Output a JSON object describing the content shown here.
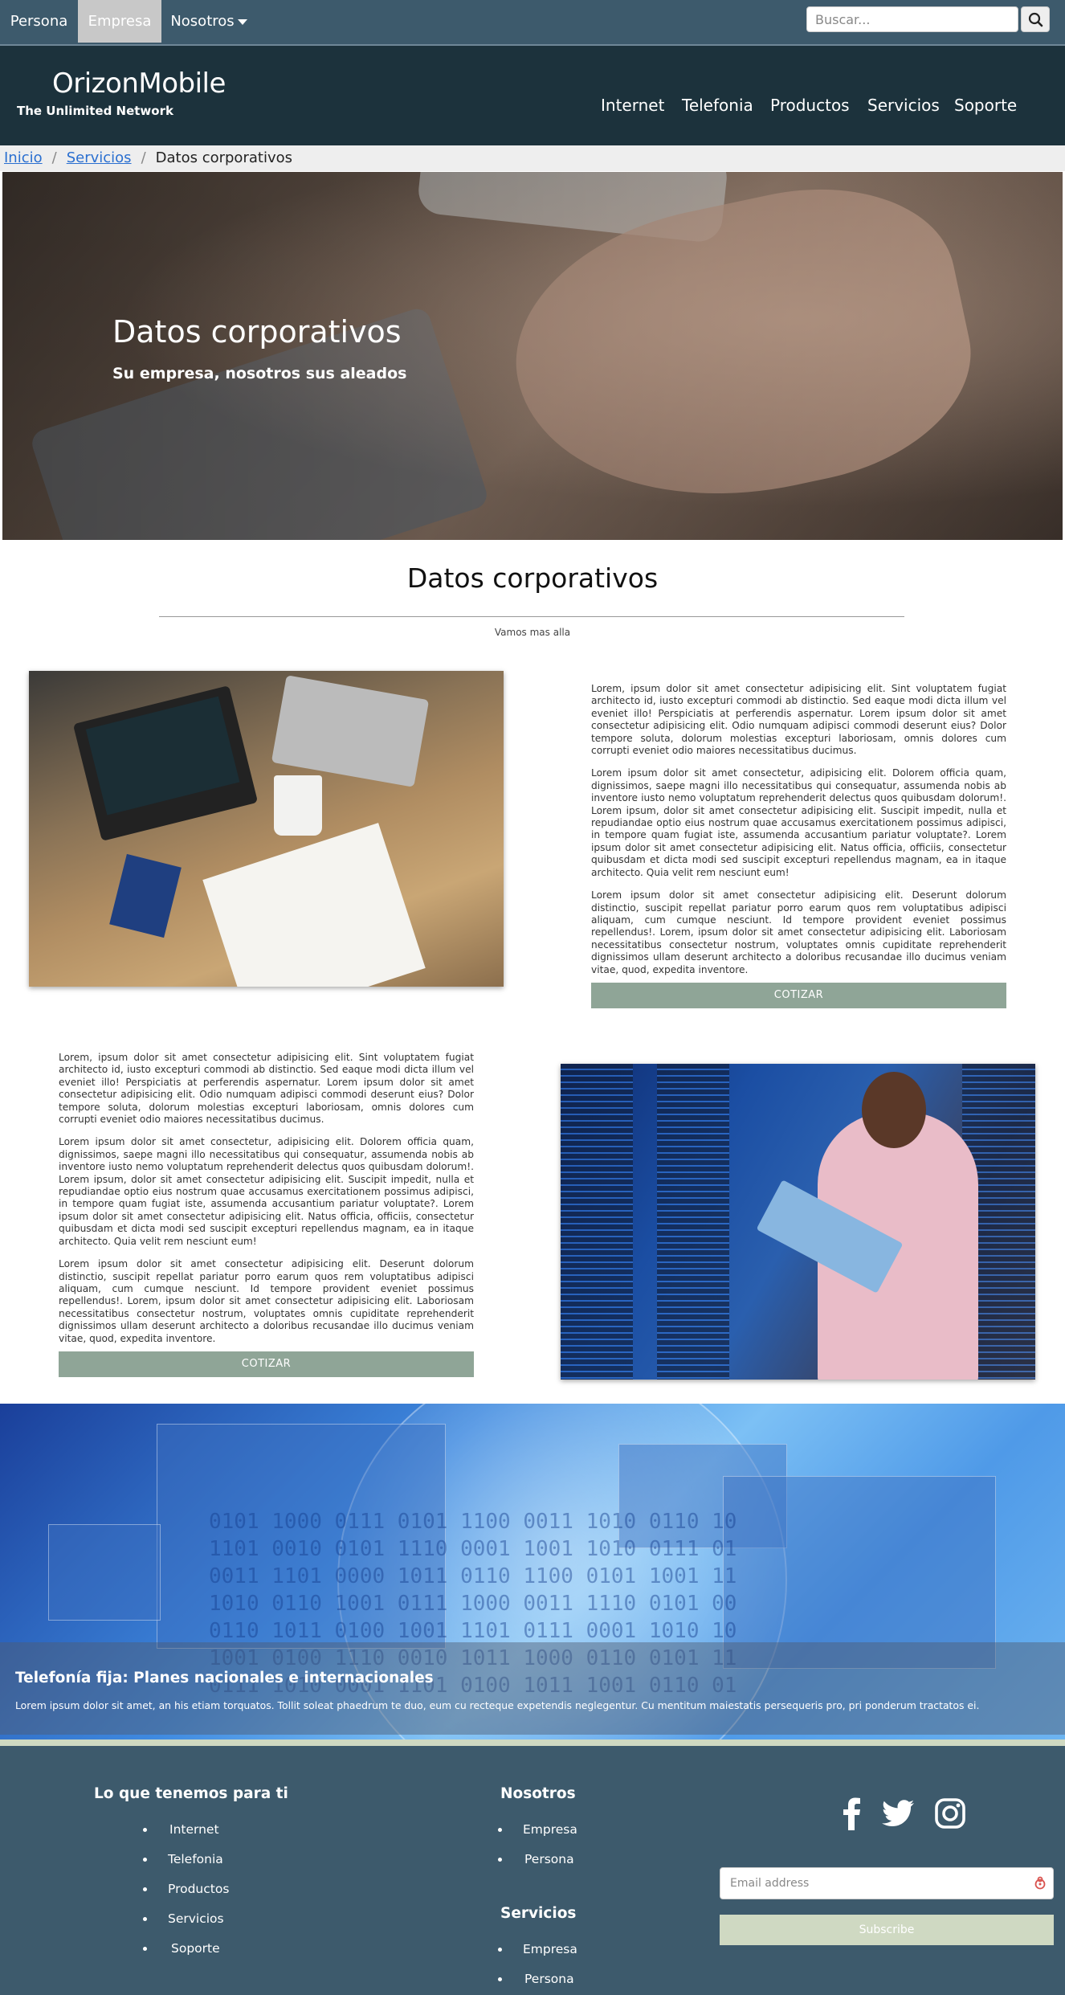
{
  "topbar": {
    "tabs": [
      {
        "label": "Persona"
      },
      {
        "label": "Empresa"
      },
      {
        "label": "Nosotros"
      }
    ],
    "search_placeholder": "Buscar..."
  },
  "header": {
    "brand": "OrizonMobile",
    "tagline": "The Unlimited Network",
    "nav": [
      "Internet",
      "Telefonia",
      "Productos",
      "Servicios",
      "Soporte"
    ]
  },
  "breadcrumb": [
    "Inicio",
    "Servicios",
    "Datos corporativos"
  ],
  "hero": {
    "title": "Datos corporativos",
    "subtitle": "Su empresa, nosotros sus aleados"
  },
  "section": {
    "title": "Datos corporativos",
    "subtitle": "Vamos mas alla"
  },
  "block1": {
    "paragraphs": [
      "Lorem, ipsum dolor sit amet consectetur adipisicing elit. Sint voluptatem fugiat architecto id, iusto excepturi commodi ab distinctio. Sed eaque modi dicta illum vel eveniet illo! Perspiciatis at perferendis aspernatur. Lorem ipsum dolor sit amet consectetur adipisicing elit. Odio numquam adipisci commodi deserunt eius? Dolor tempore soluta, dolorum molestias excepturi laboriosam, omnis dolores cum corrupti eveniet odio maiores necessitatibus ducimus.",
      "Lorem ipsum dolor sit amet consectetur, adipisicing elit. Dolorem officia quam, dignissimos, saepe magni illo necessitatibus qui consequatur, assumenda nobis ab inventore iusto nemo voluptatum reprehenderit delectus quos quibusdam dolorum!. Lorem ipsum, dolor sit amet consectetur adipisicing elit. Suscipit impedit, nulla et repudiandae optio eius nostrum quae accusamus exercitationem possimus adipisci, in tempore quam fugiat iste, assumenda accusantium pariatur voluptate?. Lorem ipsum dolor sit amet consectetur adipisicing elit. Natus officia, officiis, consectetur quibusdam et dicta modi sed suscipit excepturi repellendus magnam, ea in itaque architecto. Quia velit rem nesciunt eum!",
      "Lorem ipsum dolor sit amet consectetur adipisicing elit. Deserunt dolorum distinctio, suscipit repellat pariatur porro earum quos rem voluptatibus adipisci aliquam, cum cumque nesciunt. Id tempore provident eveniet possimus repellendus!. Lorem, ipsum dolor sit amet consectetur adipisicing elit. Laboriosam necessitatibus consectetur nostrum, voluptates omnis cupiditate reprehenderit dignissimos ullam deserunt architecto a doloribus recusandae illo ducimus veniam vitae, quod, expedita inventore."
    ],
    "button": "COTIZAR"
  },
  "block2": {
    "paragraphs": [
      "Lorem, ipsum dolor sit amet consectetur adipisicing elit. Sint voluptatem fugiat architecto id, iusto excepturi commodi ab distinctio. Sed eaque modi dicta illum vel eveniet illo! Perspiciatis at perferendis aspernatur. Lorem ipsum dolor sit amet consectetur adipisicing elit. Odio numquam adipisci commodi deserunt eius? Dolor tempore soluta, dolorum molestias excepturi laboriosam, omnis dolores cum corrupti eveniet odio maiores necessitatibus ducimus.",
      "Lorem ipsum dolor sit amet consectetur, adipisicing elit. Dolorem officia quam, dignissimos, saepe magni illo necessitatibus qui consequatur, assumenda nobis ab inventore iusto nemo voluptatum reprehenderit delectus quos quibusdam dolorum!. Lorem ipsum, dolor sit amet consectetur adipisicing elit. Suscipit impedit, nulla et repudiandae optio eius nostrum quae accusamus exercitationem possimus adipisci, in tempore quam fugiat iste, assumenda accusantium pariatur voluptate?. Lorem ipsum dolor sit amet consectetur adipisicing elit. Natus officia, officiis, consectetur quibusdam et dicta modi sed suscipit excepturi repellendus magnam, ea in itaque architecto. Quia velit rem nesciunt eum!",
      "Lorem ipsum dolor sit amet consectetur adipisicing elit. Deserunt dolorum distinctio, suscipit repellat pariatur porro earum quos rem voluptatibus adipisci aliquam, cum cumque nesciunt. Id tempore provident eveniet possimus repellendus!. Lorem, ipsum dolor sit amet consectetur adipisicing elit. Laboriosam necessitatibus consectetur nostrum, voluptates omnis cupiditate reprehenderit dignissimos ullam deserunt architecto a doloribus recusandae illo ducimus veniam vitae, quod, expedita inventore."
    ],
    "button": "COTIZAR"
  },
  "banner": {
    "title": "Telefonía fija: Planes nacionales e internacionales",
    "text": "Lorem ipsum dolor sit amet, an his etiam torquatos. Tollit soleat phaedrum te duo, eum cu recteque expetendis neglegentur. Cu mentitum maiestatis persequeris pro, pri ponderum tractatos ei."
  },
  "footer": {
    "col1": {
      "heading": "Lo que tenemos para ti",
      "items": [
        "Internet",
        "Telefonia",
        "Productos",
        "Servicios",
        "Soporte"
      ]
    },
    "col2": {
      "heading": "Nosotros",
      "items": [
        "Empresa",
        "Persona"
      ]
    },
    "col3": {
      "heading": "Servicios",
      "items": [
        "Empresa",
        "Persona"
      ]
    },
    "social": [
      "facebook-icon",
      "twitter-icon",
      "instagram-icon"
    ],
    "email_placeholder": "Email address",
    "subscribe": "Subscribe"
  },
  "colors": {
    "topbar": "#3d5a6c",
    "header": "#1c323c",
    "button": "#8fa597",
    "footer_accent": "#cfd9c2"
  }
}
